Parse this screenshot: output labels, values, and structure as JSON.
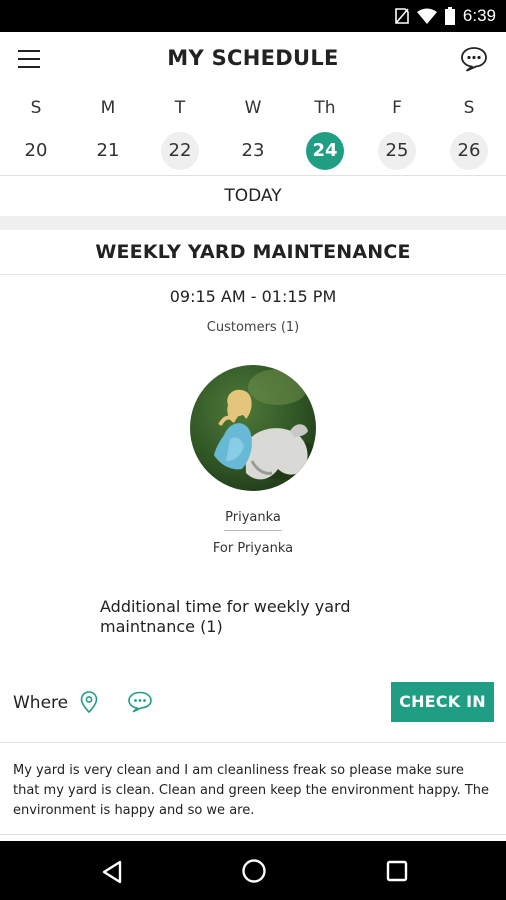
{
  "status_bar": {
    "time": "6:39"
  },
  "app_bar": {
    "title": "MY SCHEDULE"
  },
  "calendar": {
    "weekdays": [
      "S",
      "M",
      "T",
      "W",
      "Th",
      "F",
      "S"
    ],
    "dates": [
      "20",
      "21",
      "22",
      "23",
      "24",
      "25",
      "26"
    ],
    "selected_date": "24",
    "today_label": "TODAY"
  },
  "event": {
    "title": "WEEKLY YARD MAINTENANCE",
    "time": "09:15 AM - 01:15 PM",
    "customers_label": "Customers (1)",
    "customer_name": "Priyanka",
    "for_label": "For Priyanka",
    "additional_time": "Additional time for weekly yard maintnance (1)",
    "where_label": "Where",
    "checkin_label": "CHECK IN",
    "notes": "My yard is very clean and I am cleanliness freak so please make sure that my yard is clean. Clean and green keep the environment happy. The environment is happy and so we are."
  },
  "colors": {
    "accent": "#1f9e84",
    "status_bar": "#000000",
    "separator": "#efefef"
  },
  "icons": [
    "menu-icon",
    "chat-icon",
    "location-pin-icon",
    "message-icon",
    "back-icon",
    "home-icon",
    "recent-apps-icon"
  ]
}
